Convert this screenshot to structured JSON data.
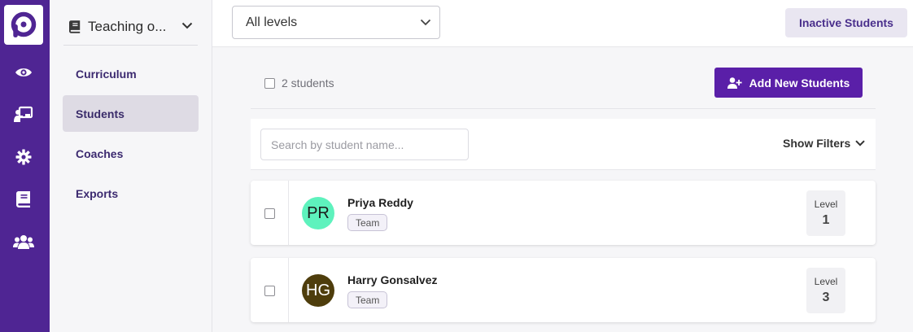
{
  "rail": {
    "icons": [
      "logo-icon",
      "eye-icon",
      "presentation-icon",
      "gear-icon",
      "book-icon",
      "users-icon"
    ]
  },
  "subnav": {
    "course_title": "Teaching o...",
    "items": [
      {
        "label": "Curriculum",
        "active": false
      },
      {
        "label": "Students",
        "active": true
      },
      {
        "label": "Coaches",
        "active": false
      },
      {
        "label": "Exports",
        "active": false
      }
    ]
  },
  "topbar": {
    "level_select": "All levels",
    "inactive_button": "Inactive Students"
  },
  "bulk": {
    "count_label": "2 students",
    "add_button": "Add New Students"
  },
  "filters": {
    "search_placeholder": "Search by student name...",
    "show_filters": "Show Filters"
  },
  "students": [
    {
      "initials": "PR",
      "name": "Priya Reddy",
      "tag": "Team",
      "level_label": "Level",
      "level": "1",
      "avatar_bg": "#5ef2bd",
      "avatar_fg": "#1a1a1a"
    },
    {
      "initials": "HG",
      "name": "Harry Gonsalvez",
      "tag": "Team",
      "level_label": "Level",
      "level": "3",
      "avatar_bg": "#4e3d0c",
      "avatar_fg": "#ffffff"
    }
  ],
  "colors": {
    "rail": "#4f2593",
    "primary_button": "#5a1fa8",
    "accent_text": "#4a2f8c"
  }
}
